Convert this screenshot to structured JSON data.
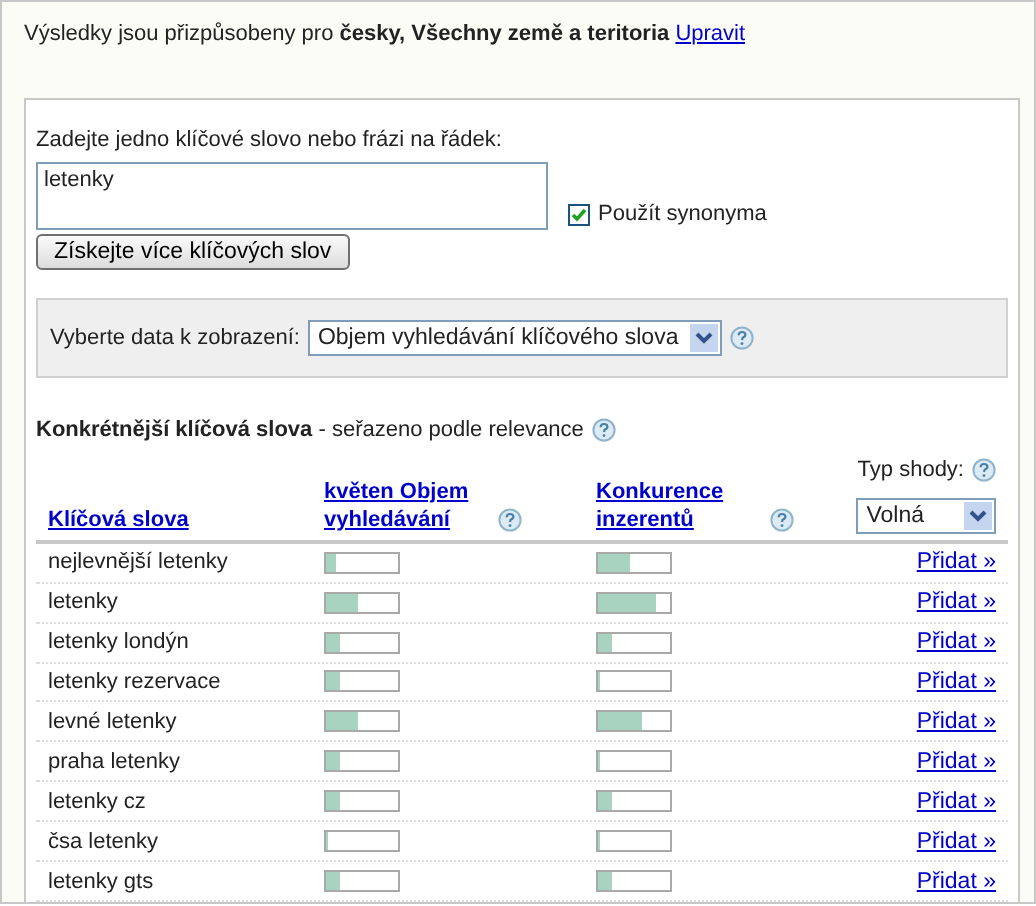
{
  "intro": {
    "text": "Výsledky jsou přizpůsobeny pro **česky, Všechny země a teritoria**",
    "link": "Upravit"
  },
  "entry": {
    "label": "Zadejte jedno klíčové slovo nebo frázi na řádek:",
    "value": "letenky",
    "synonyms": {
      "label": "Použít synonyma",
      "checked": true
    },
    "button": "Získejte více klíčových slov"
  },
  "display": {
    "label": "Vyberte data k zobrazení:",
    "value": "Objem vyhledávání klíčového slova"
  },
  "section": {
    "title": "**Konkrétnější klíčová slova** - seřazeno podle relevance"
  },
  "table": {
    "columns": [
      "Klíčová slova",
      "květen Objem vyhledávání",
      "Konkurence inzerentů"
    ],
    "match_label": "Typ shody:",
    "match_value": "Volná",
    "rows": [
      {
        "keyword": "nejlevnější letenky",
        "volume": {
          "level": 0.15
        },
        "competition": {
          "level": 0.45
        },
        "action": "Přidat »"
      },
      {
        "keyword": "letenky",
        "volume": {
          "level": 0.45
        },
        "competition": {
          "level": 0.8
        },
        "action": "Přidat »"
      },
      {
        "keyword": "letenky londýn",
        "volume": {
          "level": 0.2
        },
        "competition": {
          "level": 0.2
        },
        "action": "Přidat »"
      },
      {
        "keyword": "letenky rezervace",
        "volume": {
          "level": 0.2
        },
        "competition": {
          "level": 0.03
        },
        "action": "Přidat »"
      },
      {
        "keyword": "levné letenky",
        "volume": {
          "level": 0.45
        },
        "competition": {
          "level": 0.6
        },
        "action": "Přidat »"
      },
      {
        "keyword": "praha letenky",
        "volume": {
          "level": 0.2
        },
        "competition": {
          "level": 0.03
        },
        "action": "Přidat »"
      },
      {
        "keyword": "letenky cz",
        "volume": {
          "level": 0.2
        },
        "competition": {
          "level": 0.2
        },
        "action": "Přidat »"
      },
      {
        "keyword": "čsa letenky",
        "volume": {
          "level": 0.03
        },
        "competition": {
          "level": 0.03
        },
        "action": "Přidat »"
      },
      {
        "keyword": "letenky gts",
        "volume": {
          "level": 0.2
        },
        "competition": {
          "level": 0.2
        },
        "action": "Přidat »"
      }
    ]
  }
}
